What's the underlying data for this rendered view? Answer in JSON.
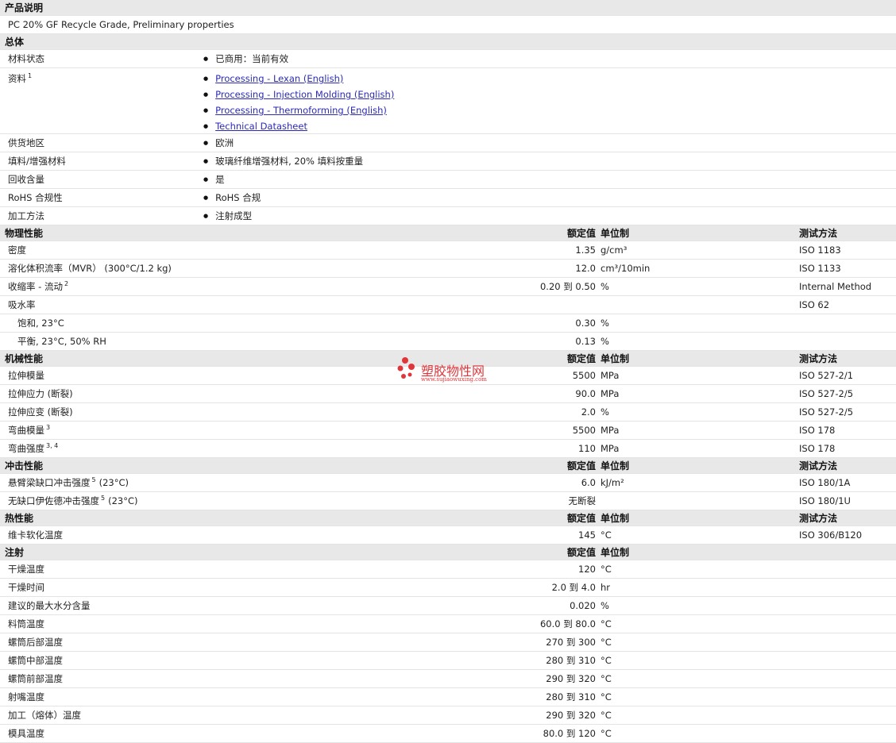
{
  "desc_title": "产品说明",
  "desc_text": "PC 20% GF Recycle Grade, Preliminary properties",
  "general": {
    "title": "总体",
    "status_label": "材料状态",
    "status_value": "已商用：当前有效",
    "docs_label": "资料",
    "docs_sup": "1",
    "docs": [
      "Processing - Lexan (English)",
      "Processing - Injection Molding (English)",
      "Processing - Thermoforming (English)",
      "Technical Datasheet"
    ],
    "region_label": "供货地区",
    "region_value": "欧洲",
    "filler_label": "填料/增强材料",
    "filler_value": "玻璃纤维增强材料, 20% 填料按重量",
    "recycle_label": "回收含量",
    "recycle_value": "是",
    "rohs_label": "RoHS 合规性",
    "rohs_value": "RoHS 合规",
    "method_label": "加工方法",
    "method_value": "注射成型"
  },
  "headers": {
    "nominal": "额定值",
    "unit": "单位制",
    "test": "测试方法"
  },
  "physical": {
    "title": "物理性能",
    "rows": [
      {
        "label": "密度",
        "sup": "",
        "value": "1.35",
        "unit": "g/cm³",
        "test": "ISO 1183"
      },
      {
        "label": "溶化体积流率（MVR） (300°C/1.2 kg)",
        "sup": "",
        "value": "12.0",
        "unit": "cm³/10min",
        "test": "ISO 1133"
      },
      {
        "label": "收缩率 - 流动",
        "sup": "2",
        "value": "0.20 到  0.50",
        "unit": "%",
        "test": "Internal Method"
      },
      {
        "label": "吸水率",
        "sup": "",
        "value": "",
        "unit": "",
        "test": "ISO 62"
      },
      {
        "label": "饱和, 23°C",
        "sup": "",
        "value": "0.30",
        "unit": "%",
        "test": "",
        "sub": true
      },
      {
        "label": "平衡, 23°C, 50% RH",
        "sup": "",
        "value": "0.13",
        "unit": "%",
        "test": "",
        "sub": true
      }
    ]
  },
  "mechanical": {
    "title": "机械性能",
    "rows": [
      {
        "label": "拉伸模量",
        "sup": "",
        "value": "5500",
        "unit": "MPa",
        "test": "ISO 527-2/1"
      },
      {
        "label": "拉伸应力 (断裂)",
        "sup": "",
        "value": "90.0",
        "unit": "MPa",
        "test": "ISO 527-2/5"
      },
      {
        "label": "拉伸应变 (断裂)",
        "sup": "",
        "value": "2.0",
        "unit": "%",
        "test": "ISO 527-2/5"
      },
      {
        "label": "弯曲模量",
        "sup": "3",
        "value": "5500",
        "unit": "MPa",
        "test": "ISO 178"
      },
      {
        "label": "弯曲强度",
        "sup": "3, 4",
        "value": "110",
        "unit": "MPa",
        "test": "ISO 178"
      }
    ]
  },
  "impact": {
    "title": "冲击性能",
    "rows": [
      {
        "label": "悬臂梁缺口冲击强度",
        "sup": "5",
        "suffix": "(23°C)",
        "value": "6.0",
        "unit": "kJ/m²",
        "test": "ISO 180/1A"
      },
      {
        "label": "无缺口伊佐德冲击强度",
        "sup": "5",
        "suffix": "(23°C)",
        "value": "无断裂",
        "unit": "",
        "test": "ISO 180/1U"
      }
    ]
  },
  "thermal": {
    "title": "热性能",
    "rows": [
      {
        "label": "维卡软化温度",
        "sup": "",
        "value": "145",
        "unit": "°C",
        "test": "ISO 306/B120"
      }
    ]
  },
  "injection": {
    "title": "注射",
    "rows": [
      {
        "label": "干燥温度",
        "value": "120",
        "unit": "°C"
      },
      {
        "label": "干燥时间",
        "value": "2.0 到  4.0",
        "unit": "hr"
      },
      {
        "label": "建议的最大水分含量",
        "value": "0.020",
        "unit": "%"
      },
      {
        "label": "料筒温度",
        "value": "60.0 到  80.0",
        "unit": "°C"
      },
      {
        "label": "螺筒后部温度",
        "value": "270 到  300",
        "unit": "°C"
      },
      {
        "label": "螺筒中部温度",
        "value": "280 到  310",
        "unit": "°C"
      },
      {
        "label": "螺筒前部温度",
        "value": "290 到  320",
        "unit": "°C"
      },
      {
        "label": "射嘴温度",
        "value": "280 到  310",
        "unit": "°C"
      },
      {
        "label": "加工（熔体）温度",
        "value": "290 到  320",
        "unit": "°C"
      },
      {
        "label": "模具温度",
        "value": "80.0 到  120",
        "unit": "°C"
      }
    ]
  },
  "watermark": {
    "name": "塑胶物性网",
    "url": "www.sujiaowuxing.com"
  }
}
